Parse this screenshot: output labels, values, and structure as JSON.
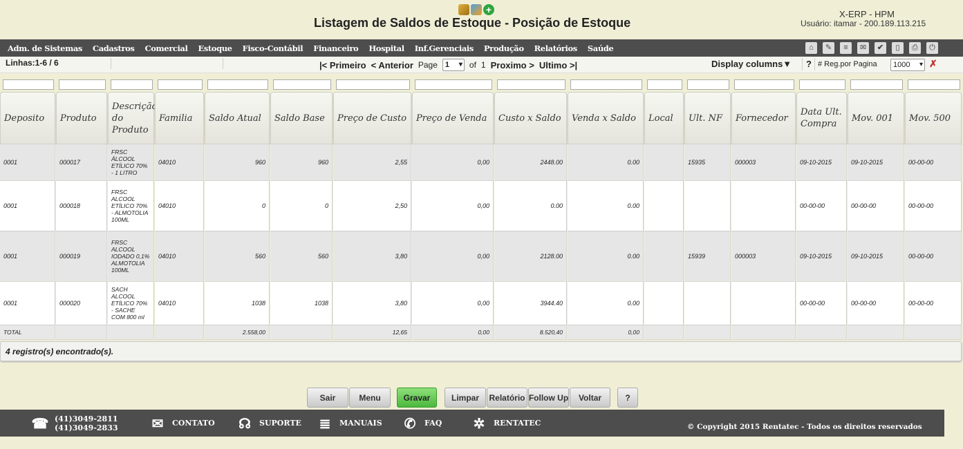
{
  "header": {
    "title": "Listagem de Saldos de Estoque - Posição de Estoque",
    "system": "X-ERP - HPM",
    "user": "Usuário: itamar - 200.189.113.215"
  },
  "menu": [
    "Adm. de Sistemas",
    "Cadastros",
    "Comercial",
    "Estoque",
    "Fisco-Contábil",
    "Financeiro",
    "Hospital",
    "Inf.Gerenciais",
    "Produção",
    "Relatórios",
    "Saúde"
  ],
  "pager": {
    "lines": "Linhas:1-6 / 6",
    "first": "|< Primeiro",
    "prev": "< Anterior",
    "page_label": "Page",
    "page_value": "1",
    "of_label": "of",
    "total_pages": "1",
    "next": "Proximo >",
    "last": "Ultimo >|",
    "display_columns": "Display columns▼",
    "help": "?",
    "reg_label": "# Reg.por Pagina",
    "reg_value": "1000"
  },
  "columns": [
    "Deposito",
    "Produto",
    "Descrição do Produto",
    "Familia",
    "Saldo Atual",
    "Saldo Base",
    "Preço de Custo",
    "Preço de Venda",
    "Custo x Saldo",
    "Venda x Saldo",
    "Local",
    "Ult. NF",
    "Fornecedor",
    "Data Ult. Compra",
    "Mov. 001",
    "Mov. 500"
  ],
  "rows": [
    [
      "0001",
      "000017",
      "FRSC ÁLCOOL ETÍLICO 70% - 1 LITRO",
      "04010",
      "960",
      "960",
      "2,55",
      "0,00",
      "2448.00",
      "0.00",
      "",
      "15935",
      "000003",
      "09-10-2015",
      "09-10-2015",
      "00-00-00"
    ],
    [
      "0001",
      "000018",
      "FRSC ALCOOL ETÍLICO 70% - ALMOTOLIA 100ML",
      "04010",
      "0",
      "0",
      "2,50",
      "0,00",
      "0.00",
      "0.00",
      "",
      "",
      "",
      "00-00-00",
      "00-00-00",
      "00-00-00"
    ],
    [
      "0001",
      "000019",
      "FRSC ALCOOL IODADO 0,1% ALMOTOLIA 100ML",
      "04010",
      "560",
      "560",
      "3,80",
      "0,00",
      "2128.00",
      "0.00",
      "",
      "15939",
      "000003",
      "09-10-2015",
      "09-10-2015",
      "00-00-00"
    ],
    [
      "0001",
      "000020",
      "SACH ALCOOL ETÍLICO 70% - SACHE COM 800 ml",
      "04010",
      "1038",
      "1038",
      "3,80",
      "0,00",
      "3944.40",
      "0.00",
      "",
      "",
      "",
      "00-00-00",
      "00-00-00",
      "00-00-00"
    ]
  ],
  "totals": [
    "TOTAL",
    "",
    "",
    "",
    "2.558,00",
    "",
    "12,65",
    "0,00",
    "8.520,40",
    "0,00",
    "",
    "",
    "",
    "",
    "",
    ""
  ],
  "found": "4 registro(s) encontrado(s).",
  "buttons": [
    "Sair",
    "Menu",
    "Gravar",
    "Limpar",
    "Relatório",
    "Follow Up",
    "Voltar",
    "?"
  ],
  "footer": {
    "phone1": "(41)3049-2811",
    "phone2": "(41)3049-2833",
    "contato": "CONTATO",
    "suporte": "SUPORTE",
    "manuais": "MANUAIS",
    "faq": "FAQ",
    "rentatec": "RENTATEC",
    "copyright": "© Copyright 2015 Rentatec - Todos os direitos reservados"
  },
  "colors": {
    "background": "#f0efd6",
    "menubar": "#4d4d4d",
    "gravar": "#4cb83e"
  },
  "icons": [
    "keys-icon",
    "home-colored-icon",
    "add-icon",
    "home-icon",
    "edit-icon",
    "document-icon",
    "mail-icon",
    "check-icon",
    "page-icon",
    "print-icon",
    "power-icon",
    "clear-filter-icon",
    "phone-icon",
    "envelope-icon",
    "headset-icon",
    "books-icon",
    "faq-icon",
    "logo-icon"
  ]
}
